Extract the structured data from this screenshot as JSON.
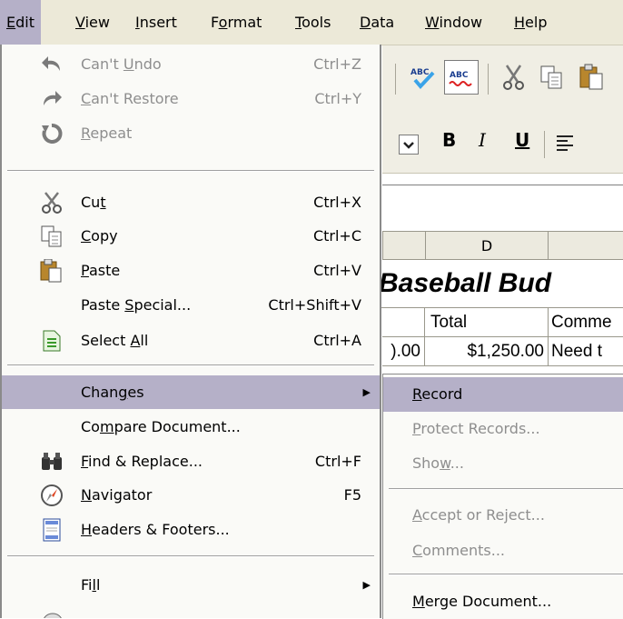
{
  "menubar": {
    "items": [
      {
        "pre": "",
        "u": "E",
        "post": "dit"
      },
      {
        "pre": "",
        "u": "V",
        "post": "iew"
      },
      {
        "pre": "",
        "u": "I",
        "post": "nsert"
      },
      {
        "pre": "F",
        "u": "o",
        "post": "rmat"
      },
      {
        "pre": "",
        "u": "T",
        "post": "ools"
      },
      {
        "pre": "",
        "u": "D",
        "post": "ata"
      },
      {
        "pre": "",
        "u": "W",
        "post": "indow"
      },
      {
        "pre": "",
        "u": "H",
        "post": "elp"
      }
    ]
  },
  "edit_menu": {
    "items": [
      {
        "pre": "Can't ",
        "u": "U",
        "post": "ndo",
        "shortcut": "Ctrl+Z",
        "icon": "undo-icon",
        "disabled": true
      },
      {
        "pre": "",
        "u": "C",
        "post": "an't Restore",
        "shortcut": "Ctrl+Y",
        "icon": "redo-icon",
        "disabled": true
      },
      {
        "pre": "",
        "u": "R",
        "post": "epeat",
        "shortcut": "",
        "icon": "repeat-icon",
        "disabled": true
      },
      {
        "pre": "Cu",
        "u": "t",
        "post": "",
        "shortcut": "Ctrl+X",
        "icon": "cut-icon",
        "disabled": false
      },
      {
        "pre": "",
        "u": "C",
        "post": "opy",
        "shortcut": "Ctrl+C",
        "icon": "copy-icon",
        "disabled": false
      },
      {
        "pre": "",
        "u": "P",
        "post": "aste",
        "shortcut": "Ctrl+V",
        "icon": "paste-icon",
        "disabled": false
      },
      {
        "pre": "Paste ",
        "u": "S",
        "post": "pecial...",
        "shortcut": "Ctrl+Shift+V",
        "icon": "",
        "disabled": false
      },
      {
        "pre": "Select ",
        "u": "A",
        "post": "ll",
        "shortcut": "Ctrl+A",
        "icon": "select-all-icon",
        "disabled": false
      },
      {
        "pre": "Chan",
        "u": "g",
        "post": "es",
        "shortcut": "",
        "icon": "",
        "disabled": false,
        "submenu": true
      },
      {
        "pre": "Co",
        "u": "m",
        "post": "pare Document...",
        "shortcut": "",
        "icon": "",
        "disabled": false
      },
      {
        "pre": "",
        "u": "F",
        "post": "ind & Replace...",
        "shortcut": "Ctrl+F",
        "icon": "binoculars-icon",
        "disabled": false
      },
      {
        "pre": "",
        "u": "N",
        "post": "avigator",
        "shortcut": "F5",
        "icon": "navigator-icon",
        "disabled": false
      },
      {
        "pre": "",
        "u": "H",
        "post": "eaders & Footers...",
        "shortcut": "",
        "icon": "headers-footers-icon",
        "disabled": false
      },
      {
        "pre": "Fi",
        "u": "l",
        "post": "l",
        "shortcut": "",
        "icon": "",
        "disabled": false,
        "submenu": true
      }
    ]
  },
  "changes_submenu": {
    "items": [
      {
        "pre": "",
        "u": "R",
        "post": "ecord",
        "disabled": false
      },
      {
        "pre": "",
        "u": "P",
        "post": "rotect Records...",
        "disabled": true
      },
      {
        "pre": "Sho",
        "u": "w",
        "post": "...",
        "disabled": true
      },
      {
        "pre": "",
        "u": "A",
        "post": "ccept or Reject...",
        "disabled": true
      },
      {
        "pre": "",
        "u": "C",
        "post": "omments...",
        "disabled": true
      },
      {
        "pre": "",
        "u": "M",
        "post": "erge Document...",
        "disabled": false
      }
    ]
  },
  "sheet": {
    "col_d_header": "D",
    "title": "Baseball Bud",
    "total_header": "Total",
    "comments_header": "Comme",
    "prev_cell_value": ").00",
    "total_value": "$1,250.00",
    "comment_value": "Need t"
  },
  "toolbar": {
    "bold": "B",
    "italic": "I",
    "underline": "U",
    "spell_auto": "ABC",
    "spell": "ABC"
  },
  "colors": {
    "highlight": "#b5b0c8",
    "menubar": "#ece9d8",
    "disabled_text": "#8e8e8e"
  }
}
